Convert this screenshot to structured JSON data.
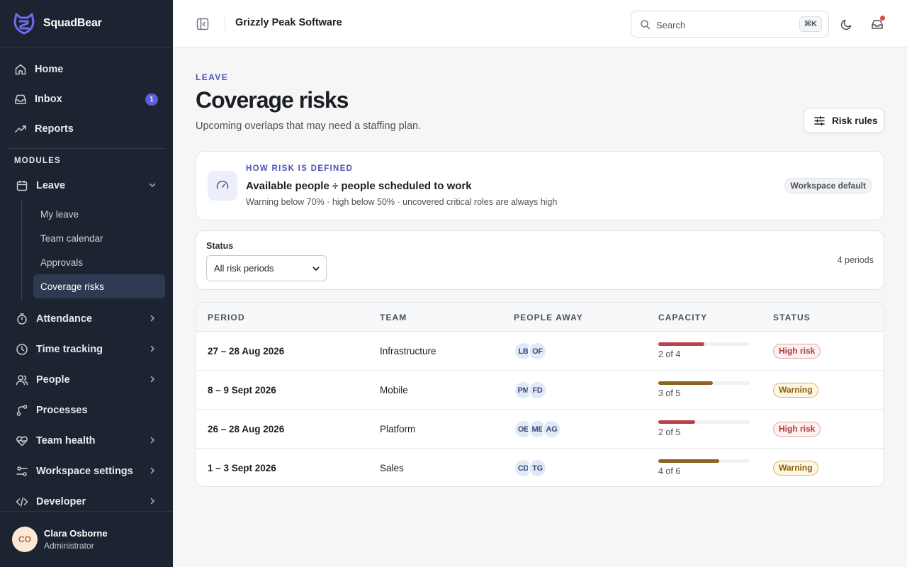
{
  "brand": {
    "name": "SquadBear"
  },
  "nav": {
    "top": [
      {
        "label": "Home",
        "icon": "home-icon"
      },
      {
        "label": "Inbox",
        "icon": "inbox-icon",
        "badge": "1"
      },
      {
        "label": "Reports",
        "icon": "trend-icon"
      }
    ],
    "section_label": "MODULES",
    "leave": {
      "label": "Leave",
      "sub": [
        "My leave",
        "Team calendar",
        "Approvals",
        "Coverage risks"
      ],
      "active": "Coverage risks"
    },
    "modules": [
      {
        "label": "Attendance",
        "icon": "timer-icon",
        "chevron": true
      },
      {
        "label": "Time tracking",
        "icon": "clock-icon",
        "chevron": true
      },
      {
        "label": "People",
        "icon": "people-icon",
        "chevron": true
      },
      {
        "label": "Processes",
        "icon": "workflow-icon",
        "chevron": false
      },
      {
        "label": "Team health",
        "icon": "heart-pulse-icon",
        "chevron": true
      },
      {
        "label": "Workspace settings",
        "icon": "sliders-icon",
        "chevron": true
      },
      {
        "label": "Developer",
        "icon": "code-icon",
        "chevron": true
      }
    ]
  },
  "user": {
    "initials": "CO",
    "name": "Clara Osborne",
    "role": "Administrator"
  },
  "topbar": {
    "org": "Grizzly Peak Software",
    "search_placeholder": "Search",
    "search_shortcut": "⌘K"
  },
  "page": {
    "eyebrow": "LEAVE",
    "title": "Coverage risks",
    "subtitle": "Upcoming overlaps that may need a staffing plan.",
    "risk_rules_label": "Risk rules"
  },
  "definition": {
    "eyebrow": "HOW RISK IS DEFINED",
    "title": "Available people ÷ people scheduled to work",
    "description": "Warning below 70% · high below 50% · uncovered critical roles are always high",
    "badge": "Workspace default"
  },
  "filter": {
    "label": "Status",
    "selected": "All risk periods",
    "count_text": "4 periods"
  },
  "table": {
    "columns": [
      "PERIOD",
      "TEAM",
      "PEOPLE AWAY",
      "CAPACITY",
      "STATUS"
    ],
    "rows": [
      {
        "period": "27 – 28 Aug 2026",
        "team": "Infrastructure",
        "away": [
          "LB",
          "OF"
        ],
        "available": 2,
        "total": 4,
        "capacity_text": "2 of 4",
        "status": "High risk",
        "level": "high"
      },
      {
        "period": "8 – 9 Sept 2026",
        "team": "Mobile",
        "away": [
          "PM",
          "FD"
        ],
        "available": 3,
        "total": 5,
        "capacity_text": "3 of 5",
        "status": "Warning",
        "level": "warn"
      },
      {
        "period": "26 – 28 Aug 2026",
        "team": "Platform",
        "away": [
          "OE",
          "ME",
          "AG"
        ],
        "available": 2,
        "total": 5,
        "capacity_text": "2 of 5",
        "status": "High risk",
        "level": "high"
      },
      {
        "period": "1 – 3 Sept 2026",
        "team": "Sales",
        "away": [
          "CD",
          "TG"
        ],
        "available": 4,
        "total": 6,
        "capacity_text": "4 of 6",
        "status": "Warning",
        "level": "warn"
      }
    ]
  },
  "colors": {
    "sidebar_bg": "#1b2430",
    "accent": "#5055b8",
    "high_bar": "#b8434a",
    "warn_bar": "#8a6420"
  }
}
